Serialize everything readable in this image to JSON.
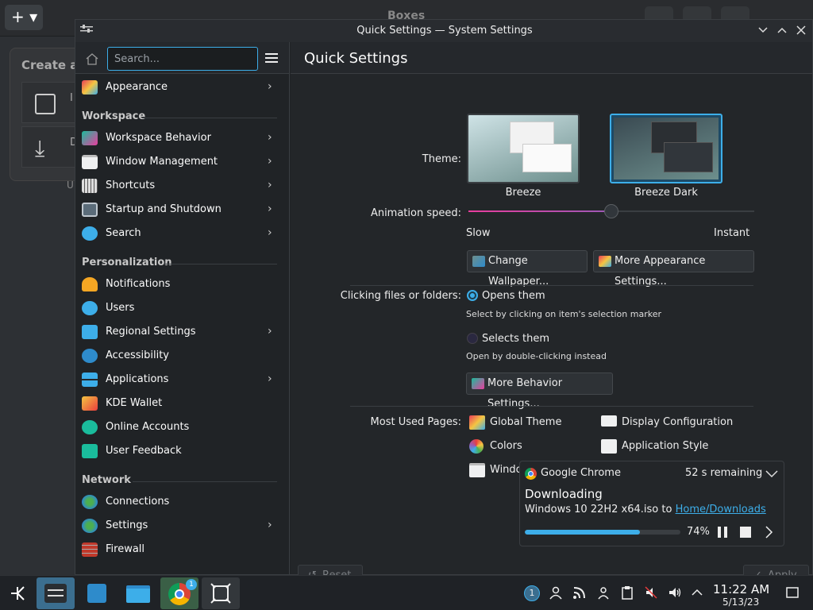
{
  "background_app": {
    "title": "Boxes",
    "card_title": "Create a",
    "item_1_initial": "I",
    "item_2_initial": "D",
    "footer_initial": "U"
  },
  "window": {
    "title": "Quick Settings — System Settings"
  },
  "sidebar": {
    "search_placeholder": "Search...",
    "top_items": [
      {
        "label": "Appearance",
        "icon": "appearance-icon"
      }
    ],
    "sections": [
      {
        "title": "Workspace",
        "items": [
          {
            "label": "Workspace Behavior",
            "icon": "workspace-behavior-icon"
          },
          {
            "label": "Window Management",
            "icon": "window-management-icon"
          },
          {
            "label": "Shortcuts",
            "icon": "keyboard-icon"
          },
          {
            "label": "Startup and Shutdown",
            "icon": "startup-icon"
          },
          {
            "label": "Search",
            "icon": "search-icon"
          }
        ]
      },
      {
        "title": "Personalization",
        "items": [
          {
            "label": "Notifications",
            "icon": "bell-icon"
          },
          {
            "label": "Users",
            "icon": "users-icon"
          },
          {
            "label": "Regional Settings",
            "icon": "regional-icon"
          },
          {
            "label": "Accessibility",
            "icon": "accessibility-icon"
          },
          {
            "label": "Applications",
            "icon": "applications-icon"
          },
          {
            "label": "KDE Wallet",
            "icon": "wallet-icon"
          },
          {
            "label": "Online Accounts",
            "icon": "online-accounts-icon"
          },
          {
            "label": "User Feedback",
            "icon": "feedback-icon"
          }
        ]
      },
      {
        "title": "Network",
        "items": [
          {
            "label": "Connections",
            "icon": "globe-icon"
          },
          {
            "label": "Settings",
            "icon": "globe-icon"
          },
          {
            "label": "Firewall",
            "icon": "firewall-icon"
          }
        ]
      }
    ]
  },
  "main": {
    "title": "Quick Settings",
    "theme_label": "Theme:",
    "themes": [
      {
        "name": "Breeze",
        "selected": false
      },
      {
        "name": "Breeze Dark",
        "selected": true
      }
    ],
    "animation_label": "Animation speed:",
    "animation_min": "Slow",
    "animation_max": "Instant",
    "animation_value": 0.5,
    "change_wallpaper": "Change Wallpaper...",
    "more_appearance": "More Appearance Settings...",
    "clicking_label": "Clicking files or folders:",
    "opens_them": "Opens them",
    "opens_hint": "Select by clicking on item's selection marker",
    "selects_them": "Selects them",
    "selects_hint": "Open by double-clicking instead",
    "more_behavior": "More Behavior Settings...",
    "most_used_label": "Most Used Pages:",
    "most_used": [
      {
        "label": "Global Theme"
      },
      {
        "label": "Display Configuration"
      },
      {
        "label": "Colors"
      },
      {
        "label": "Application Style"
      },
      {
        "label": "Window Decorations"
      }
    ],
    "reset": "Reset",
    "apply": "Apply"
  },
  "notification": {
    "app": "Google Chrome",
    "remaining": "52 s remaining",
    "title": "Downloading",
    "body_prefix": "Windows 10 22H2 x64.iso to ",
    "link": "Home/Downloads",
    "progress": 0.74,
    "percent": "74%"
  },
  "taskbar": {
    "chrome_badge": "1",
    "tray_badge": "1",
    "time": "11:22 AM",
    "date": "5/13/23"
  },
  "colors": {
    "accent": "#3daee9",
    "slider_gradient_start": "#e93d9e",
    "slider_gradient_end": "#3daee9"
  }
}
